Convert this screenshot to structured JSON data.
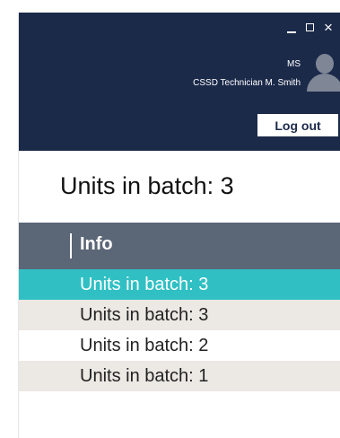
{
  "window": {
    "minimize_icon": "minimize-icon",
    "maximize_icon": "maximize-icon",
    "close_icon": "close-icon",
    "close_glyph": "×"
  },
  "header": {
    "user_initials": "MS",
    "user_role": "CSSD Technician M. Smith",
    "avatar_icon": "user-avatar-icon",
    "logout_label": "Log out",
    "background_color": "#1c2a4a"
  },
  "main": {
    "title": "Units in batch: 3"
  },
  "grid": {
    "columns": [
      "Info"
    ],
    "rows": [
      {
        "info": "Units in batch: 3",
        "selected": true
      },
      {
        "info": "Units in batch: 3",
        "selected": false
      },
      {
        "info": "Units in batch: 2",
        "selected": false
      },
      {
        "info": "Units in batch: 1",
        "selected": false
      }
    ],
    "selected_color": "#30c0c4",
    "header_color": "#5b6676"
  }
}
